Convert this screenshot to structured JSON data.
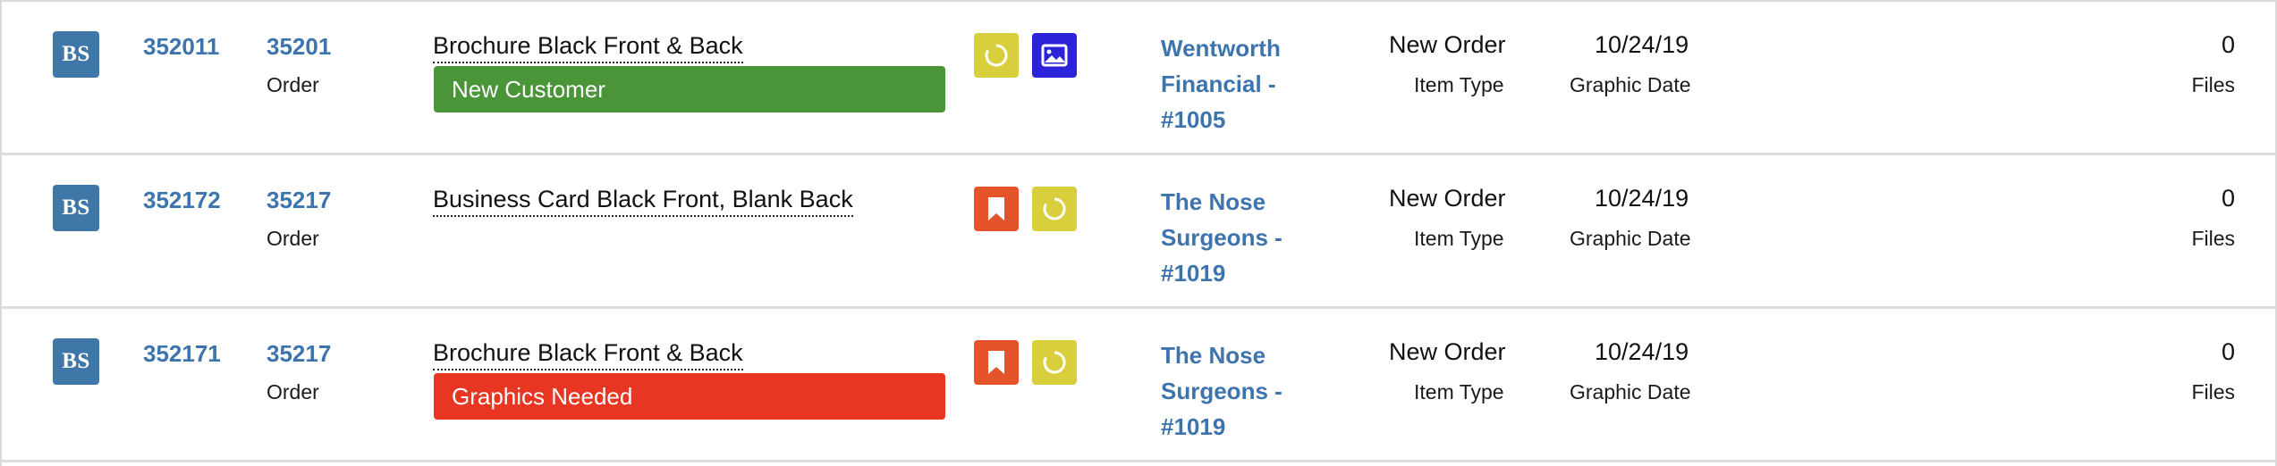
{
  "rows": [
    {
      "avatar": "BS",
      "id": "352011",
      "order_number": "35201",
      "order_label": "Order",
      "product": "Brochure Black Front & Back",
      "tag": "New Customer",
      "tag_color": "#4a9538",
      "icons": [
        "refresh-icon",
        "image-icon"
      ],
      "client": "Wentworth Financial - #1005",
      "status": "New Order",
      "status_label": "Item Type",
      "date": "10/24/19",
      "date_label": "Graphic Date",
      "files": "0",
      "files_label": "Files"
    },
    {
      "avatar": "BS",
      "id": "352172",
      "order_number": "35217",
      "order_label": "Order",
      "product": "Business Card Black Front, Blank Back",
      "tag": "",
      "icons": [
        "bookmark-icon",
        "refresh-icon"
      ],
      "client": "The Nose Surgeons - #1019",
      "status": "New Order",
      "status_label": "Item Type",
      "date": "10/24/19",
      "date_label": "Graphic Date",
      "files": "0",
      "files_label": "Files"
    },
    {
      "avatar": "BS",
      "id": "352171",
      "order_number": "35217",
      "order_label": "Order",
      "product": "Brochure Black Front & Back",
      "tag": "Graphics Needed",
      "tag_color": "#e83623",
      "icons": [
        "bookmark-icon",
        "refresh-icon"
      ],
      "client": "The Nose Surgeons - #1019",
      "status": "New Order",
      "status_label": "Item Type",
      "date": "10/24/19",
      "date_label": "Graphic Date",
      "files": "0",
      "files_label": "Files"
    }
  ],
  "colors": {
    "link": "#3e74ae",
    "avatar": "#3f78a8",
    "icon_yellow": "#d9cf3d",
    "icon_blue": "#2b22d9",
    "icon_orange": "#e4532a"
  }
}
